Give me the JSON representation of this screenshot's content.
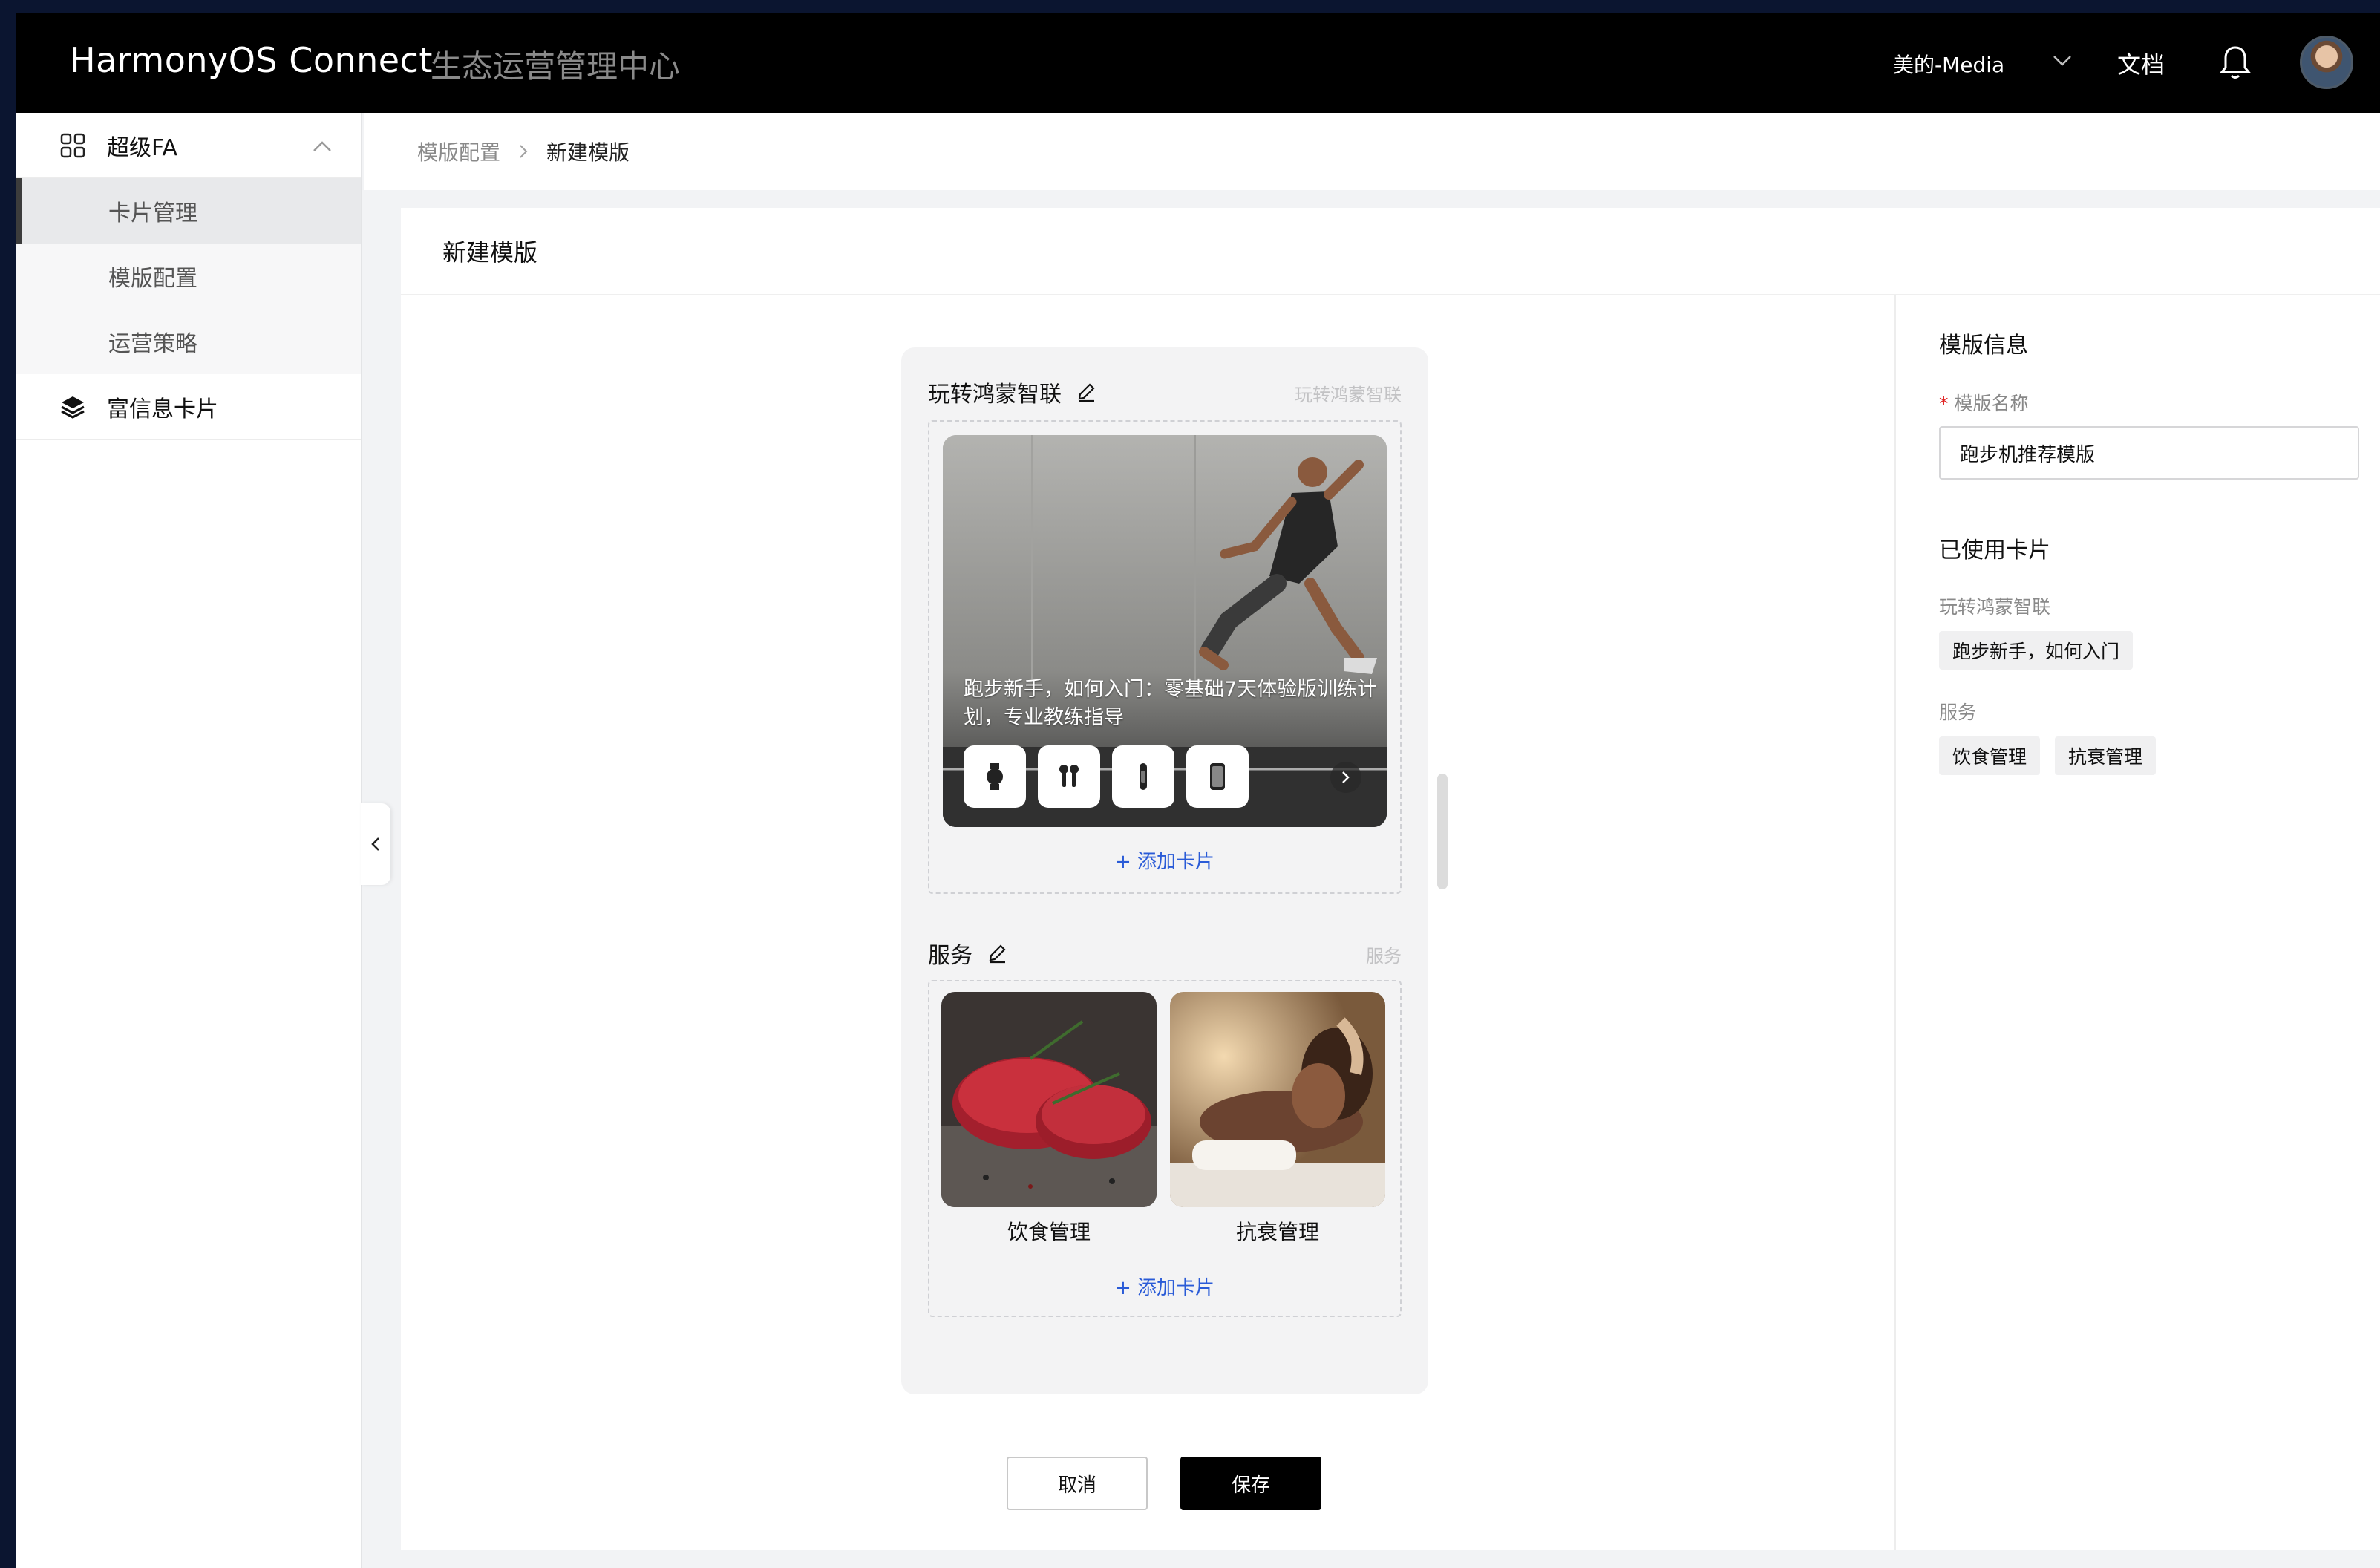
{
  "topbar": {
    "brand": "HarmonyOS Connect",
    "subtitle": "生态运营管理中心",
    "account": "美的-Media",
    "docs": "文档"
  },
  "sidebar": {
    "groups": [
      {
        "label": "超级FA",
        "icon": "grid-icon",
        "expanded": true,
        "items": [
          {
            "label": "卡片管理",
            "active": true
          },
          {
            "label": "模版配置",
            "active": false
          },
          {
            "label": "运营策略",
            "active": false
          }
        ]
      },
      {
        "label": "富信息卡片",
        "icon": "layers-icon",
        "expanded": false
      }
    ]
  },
  "breadcrumb": {
    "parent": "模版配置",
    "current": "新建模版"
  },
  "panel": {
    "title": "新建模版"
  },
  "preview": {
    "section1": {
      "title": "玩转鸿蒙智联",
      "hint": "玩转鸿蒙智联",
      "hero_text": "跑步新手，如何入门：零基础7天体验版训练计划，专业教练指导",
      "devices": [
        "watch-icon",
        "earbuds-icon",
        "band-icon",
        "phone-icon"
      ],
      "add_card": "+ 添加卡片"
    },
    "section2": {
      "title": "服务",
      "hint": "服务",
      "cards": [
        {
          "label": "饮食管理"
        },
        {
          "label": "抗衰管理"
        }
      ],
      "add_card": "+ 添加卡片"
    }
  },
  "actions": {
    "cancel": "取消",
    "save": "保存"
  },
  "info": {
    "heading": "模版信息",
    "name_label": "模版名称",
    "required_mark": "*",
    "name_value": "跑步机推荐模版",
    "used_heading": "已使用卡片",
    "groups": [
      {
        "label": "玩转鸿蒙智联",
        "tags": [
          "跑步新手，如何入门"
        ]
      },
      {
        "label": "服务",
        "tags": [
          "饮食管理",
          "抗衰管理"
        ]
      }
    ]
  }
}
